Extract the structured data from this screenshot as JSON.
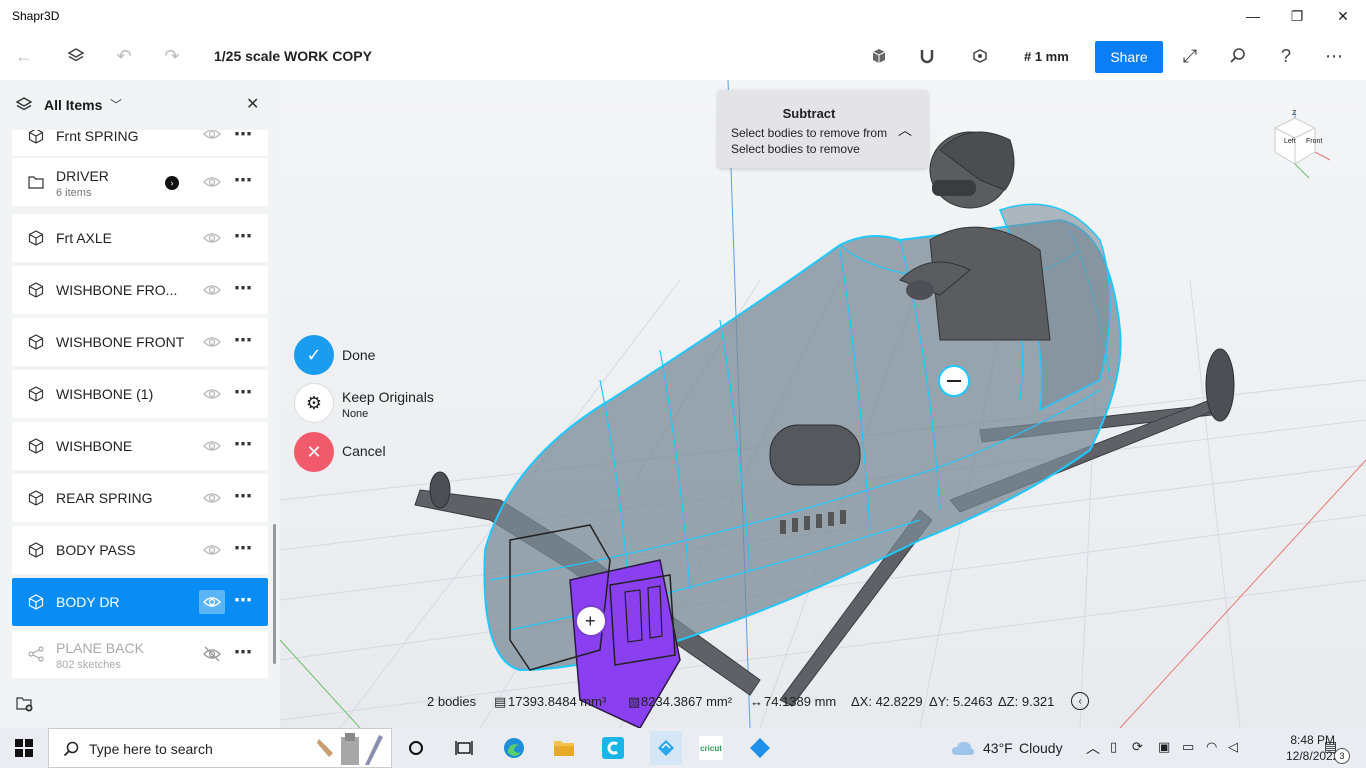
{
  "app": {
    "title": "Shapr3D"
  },
  "toolbar": {
    "document_title": "1/25 scale WORK COPY",
    "grid_label": "# 1 mm",
    "share_label": "Share"
  },
  "sidebar": {
    "title": "All Items",
    "items": [
      {
        "label": "Frnt SPRING"
      },
      {
        "label": "DRIVER",
        "sub": "6 items"
      },
      {
        "label": "Frt AXLE"
      },
      {
        "label": "WISHBONE FRO..."
      },
      {
        "label": "WISHBONE FRONT"
      },
      {
        "label": "WISHBONE (1)"
      },
      {
        "label": "WISHBONE"
      },
      {
        "label": "REAR SPRING"
      },
      {
        "label": "BODY  PASS"
      },
      {
        "label": "BODY DR"
      },
      {
        "label": "PLANE BACK",
        "sub": "802 sketches"
      }
    ]
  },
  "subtract": {
    "title": "Subtract",
    "line1": "Select bodies to remove from",
    "line2": "Select bodies to remove"
  },
  "actions": {
    "done": "Done",
    "keep_originals": "Keep Originals",
    "keep_value": "None",
    "cancel": "Cancel"
  },
  "statusbar": {
    "bodies": "2 bodies",
    "volume": "17393.8484 mm³",
    "area": "8234.3867 mm²",
    "length": "74.1389 mm",
    "dx": "ΔX: 42.8229",
    "dy": "ΔY: 5.2463",
    "dz": "ΔZ: 9.321"
  },
  "viewcube": {
    "left": "Left",
    "front": "Front",
    "top": "Z"
  },
  "taskbar": {
    "search_placeholder": "Type here to search",
    "weather_temp": "43°F",
    "weather_desc": "Cloudy",
    "time": "8:48 PM",
    "date": "12/8/2022",
    "notifications": "3",
    "cricut": "cricut"
  },
  "colors": {
    "accent": "#0a8cf5",
    "selection": "#1ec8ff",
    "done": "#1a9cf0",
    "cancel": "#f05a6a",
    "purple": "#8a3ff0"
  }
}
